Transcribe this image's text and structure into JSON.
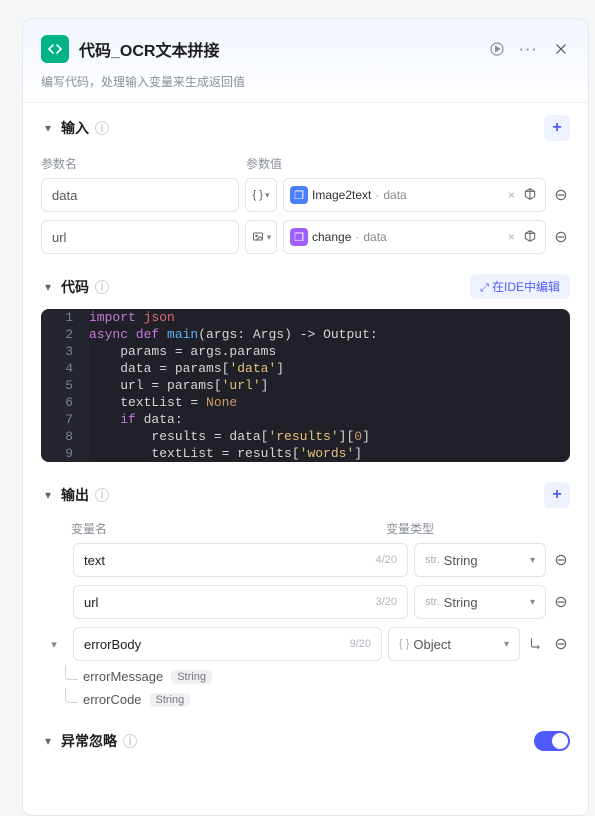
{
  "header": {
    "title": "代码_OCR文本拼接",
    "subtitle": "编写代码，处理输入变量来生成返回值"
  },
  "input": {
    "title": "输入",
    "col_name": "参数名",
    "col_value": "参数值",
    "rows": [
      {
        "name": "data",
        "type": "{ }",
        "source": "Image2text",
        "field": "data",
        "cube": "blue"
      },
      {
        "name": "url",
        "type": "img",
        "source": "change",
        "field": "data",
        "cube": "purple"
      }
    ]
  },
  "code": {
    "title": "代码",
    "ide_label": "在IDE中编辑",
    "lines": [
      {
        "n": 1,
        "html": "<span class='kw'>import</span> <span class='var'>json</span>"
      },
      {
        "n": 2,
        "html": "<span class='kw'>async def</span> <span class='fn'>main</span>(args: Args) -&gt; Output:"
      },
      {
        "n": 3,
        "html": "    params = args.params"
      },
      {
        "n": 4,
        "html": "    data = params[<span class='str'>'data'</span>]"
      },
      {
        "n": 5,
        "html": "    url = params[<span class='str'>'url'</span>]"
      },
      {
        "n": 6,
        "html": "    textList = <span class='none'>None</span>"
      },
      {
        "n": 7,
        "html": "    <span class='kw'>if</span> data:"
      },
      {
        "n": 8,
        "html": "        results = data[<span class='str'>'results'</span>][<span class='none'>0</span>]"
      },
      {
        "n": 9,
        "html": "        textList = results[<span class='str'>'words'</span>]"
      }
    ]
  },
  "output": {
    "title": "输出",
    "col_name": "变量名",
    "col_type": "变量类型",
    "rows": [
      {
        "name": "text",
        "count": "4/20",
        "type_pre": "str.",
        "type": "String",
        "expandable": false
      },
      {
        "name": "url",
        "count": "3/20",
        "type_pre": "str.",
        "type": "String",
        "expandable": false
      },
      {
        "name": "errorBody",
        "count": "9/20",
        "type_pre": "{ }",
        "type": "Object",
        "expandable": true,
        "children": [
          {
            "name": "errorMessage",
            "type": "String"
          },
          {
            "name": "errorCode",
            "type": "String"
          }
        ]
      }
    ]
  },
  "exception": {
    "title": "异常忽略"
  }
}
